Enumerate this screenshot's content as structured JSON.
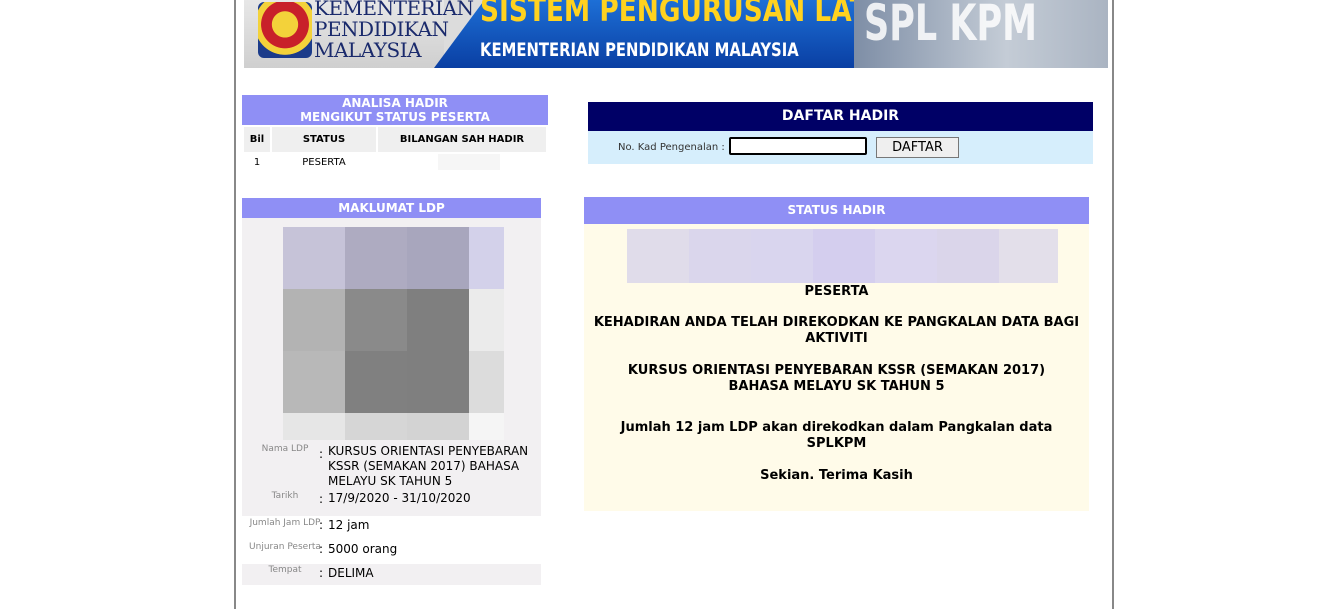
{
  "banner": {
    "ministry": [
      "KEMENTERIAN",
      "PENDIDIKAN",
      "MALAYSIA"
    ],
    "system_title": "SISTEM PENGURUSAN LATIHAN",
    "system_subtitle": "KEMENTERIAN PENDIDIKAN MALAYSIA",
    "short_title": "SPL KPM"
  },
  "analisa": {
    "title_line1": "ANALISA HADIR",
    "title_line2": "MENGIKUT STATUS PESERTA",
    "columns": [
      "Bil",
      "STATUS",
      "BILANGAN SAH HADIR"
    ],
    "rows": [
      {
        "bil": "1",
        "status": "PESERTA",
        "count": ""
      }
    ]
  },
  "daftar": {
    "title": "DAFTAR HADIR",
    "ic_label": "No. Kad Pengenalan :",
    "ic_value": "",
    "button_label": "DAFTAR"
  },
  "maklumat": {
    "title": "MAKLUMAT LDP",
    "fields": [
      {
        "label": "Nama LDP",
        "value": "KURSUS ORIENTASI PENYEBARAN KSSR (SEMAKAN 2017) BAHASA MELAYU SK TAHUN 5"
      },
      {
        "label": "Tarikh",
        "value": "17/9/2020 - 31/10/2020"
      },
      {
        "label": "Jumlah Jam LDP",
        "value": "12 jam"
      },
      {
        "label": "Unjuran Peserta",
        "value": "5000 orang"
      },
      {
        "label": "Tempat",
        "value": "DELIMA"
      }
    ]
  },
  "status": {
    "title": "STATUS HADIR",
    "role": "PESERTA",
    "message": "KEHADIRAN ANDA TELAH DIREKODKAN KE PANGKALAN DATA BAGI AKTIVITI",
    "course": "KURSUS ORIENTASI PENYEBARAN KSSR (SEMAKAN 2017) BAHASA MELAYU SK TAHUN 5",
    "hours_note": "Jumlah 12 jam LDP akan direkodkan dalam Pangkalan data SPLKPM",
    "closing": "Sekian. Terima Kasih"
  },
  "colors": {
    "section_header": "#8f8ff5",
    "daftar_header": "#000066",
    "daftar_bg": "#d6eefc",
    "status_bg": "#fffbe9"
  }
}
